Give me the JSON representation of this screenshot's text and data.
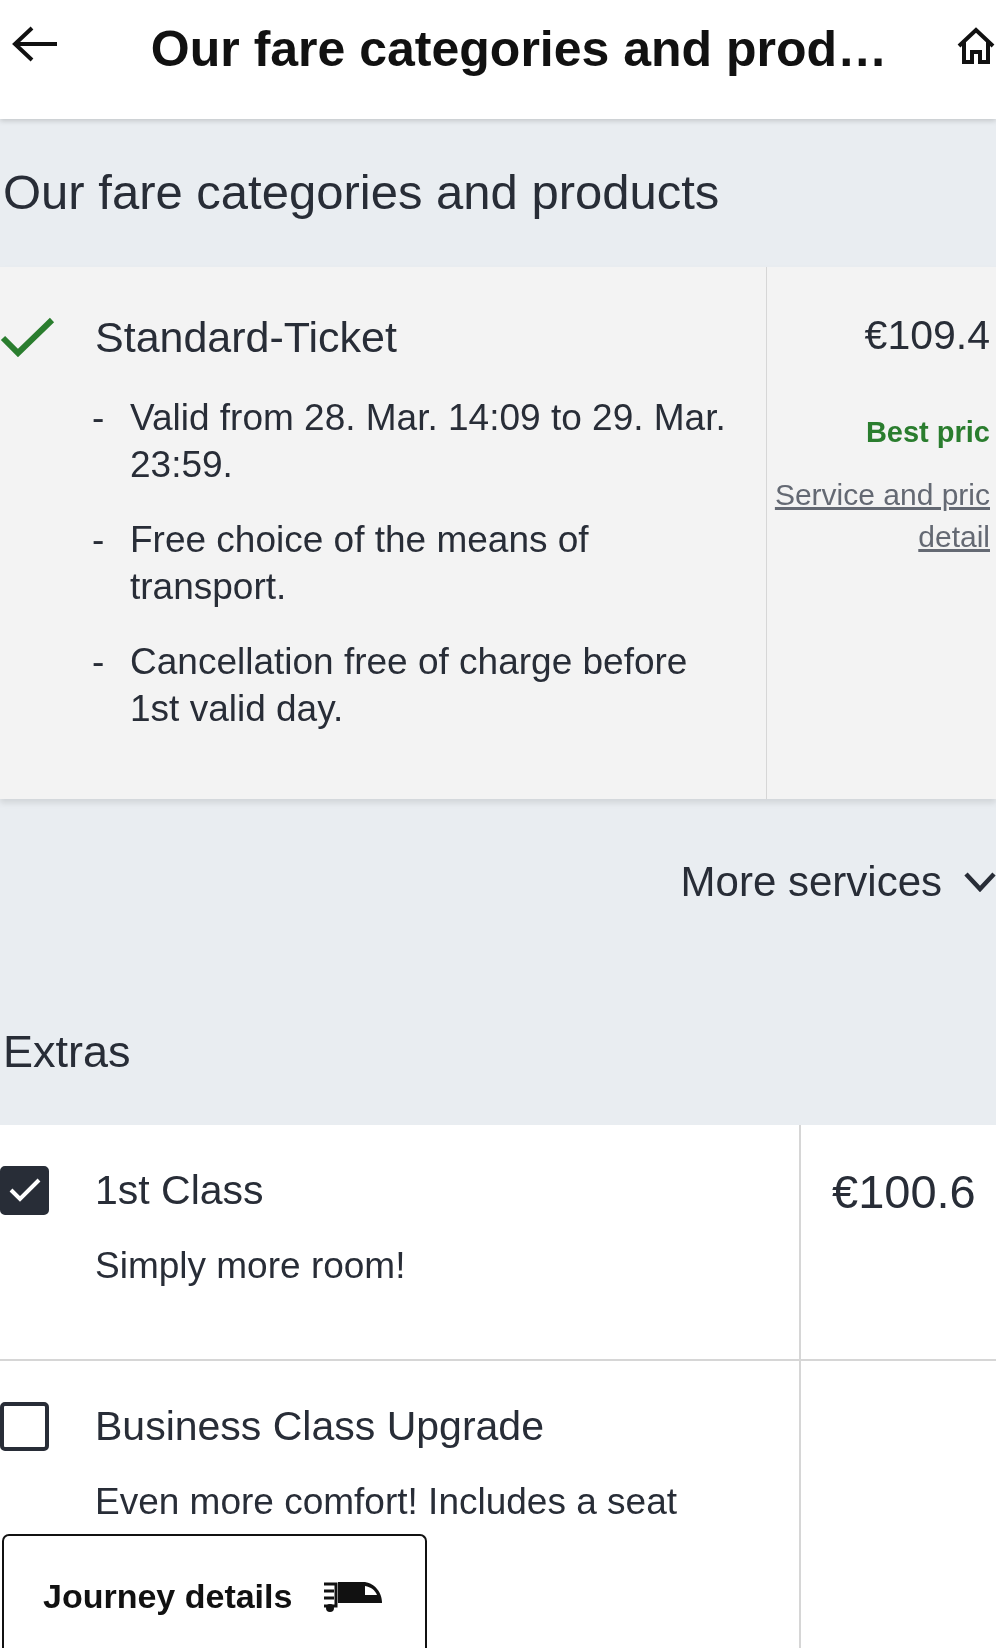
{
  "app_bar": {
    "title": "Our fare categories and prod…"
  },
  "fare_section": {
    "heading": "Our fare categories and products",
    "fares": [
      {
        "name": "Standard-Ticket",
        "selected": true,
        "conditions": [
          {
            "bullet": "-",
            "text": "Valid from 28. Mar. 14:09 to 29. Mar. 23:59."
          },
          {
            "bullet": "-",
            "text": "Free choice of the means of transport."
          },
          {
            "bullet": "-",
            "text": "Cancellation free of charge before 1st valid day."
          }
        ],
        "price": "€109.4",
        "badge": "Best pric",
        "details_link": "Service and pric\ndetail"
      }
    ],
    "more_services": {
      "label": "More services",
      "expanded": false
    }
  },
  "extras_section": {
    "heading": "Extras",
    "extras": [
      {
        "name": "1st Class",
        "description": "Simply more room!",
        "price": "€100.6",
        "checked": true
      },
      {
        "name": "Business Class Upgrade",
        "description": "Even more comfort! Includes a seat",
        "checked": false
      }
    ]
  },
  "journey_button": {
    "label": "Journey details"
  }
}
